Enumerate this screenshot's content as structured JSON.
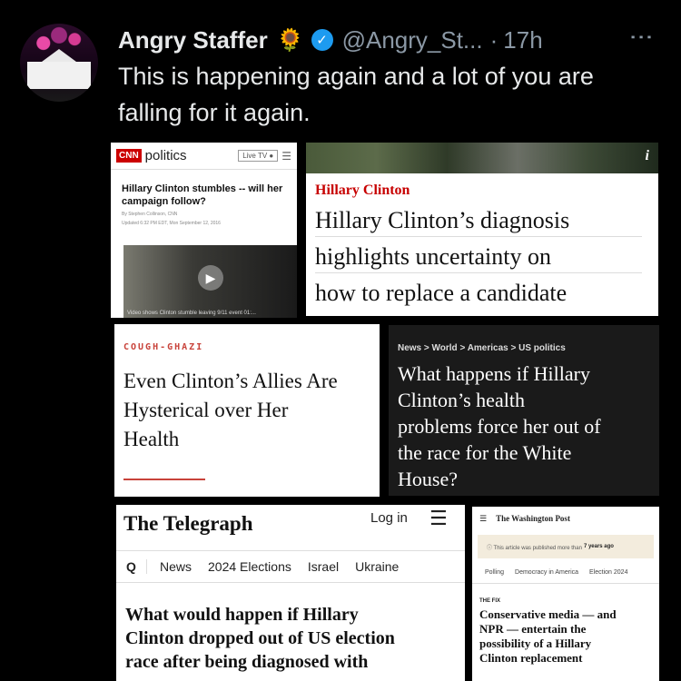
{
  "tweet": {
    "author_name": "Angry Staffer",
    "emoji": "🌻",
    "handle": "@Angry_St...",
    "separator": "·",
    "time": "17h",
    "more_icon": "⋮",
    "text": "This is happening again and a lot of you are falling for it again."
  },
  "cnn": {
    "logo": "CNN",
    "section": "politics",
    "live_tv": "Live TV ●",
    "menu": "☰",
    "headline": "Hillary Clinton stumbles -- will her campaign follow?",
    "byline": "By Stephen Collinson, CNN",
    "updated": "Updated 6:32 PM EDT, Mon September 12, 2016",
    "play": "▶",
    "video_caption": "Video shows Clinton stumble leaving 9/11 event 01:..."
  },
  "guardian1": {
    "info": "i",
    "kicker": "Hillary Clinton",
    "headline_lines": [
      "Hillary Clinton’s diagnosis",
      "highlights uncertainty on",
      "how to replace a candidate"
    ]
  },
  "coughghazi": {
    "kicker": "COUGH-GHAZI",
    "headline_lines": [
      "Even Clinton’s Allies Are",
      "Hysterical over Her",
      "Health"
    ]
  },
  "guardian2": {
    "breadcrumb": "News > World > Americas > US politics",
    "headline_lines": [
      "What happens if Hillary",
      "Clinton’s health",
      "problems force her out of",
      "the race for the White",
      "House?"
    ]
  },
  "telegraph": {
    "logo": "The Telegraph",
    "login": "Log in",
    "menu": "☰",
    "search": "Q",
    "nav": [
      "News",
      "2024 Elections",
      "Israel",
      "Ukraine"
    ],
    "headline_lines": [
      "What would happen if Hillary",
      "Clinton dropped out of US election",
      "race after being diagnosed with"
    ]
  },
  "wapo": {
    "menu": "☰",
    "logo": "The Washington Post",
    "notice_prefix": "ⓘ This article was published more than",
    "notice_bold": "7 years ago",
    "nav": [
      "Polling",
      "Democracy in America",
      "Election 2024"
    ],
    "section": "THE FIX",
    "headline_lines": [
      "Conservative media — and",
      "NPR — entertain the",
      "possibility of a Hillary",
      "Clinton replacement"
    ]
  }
}
